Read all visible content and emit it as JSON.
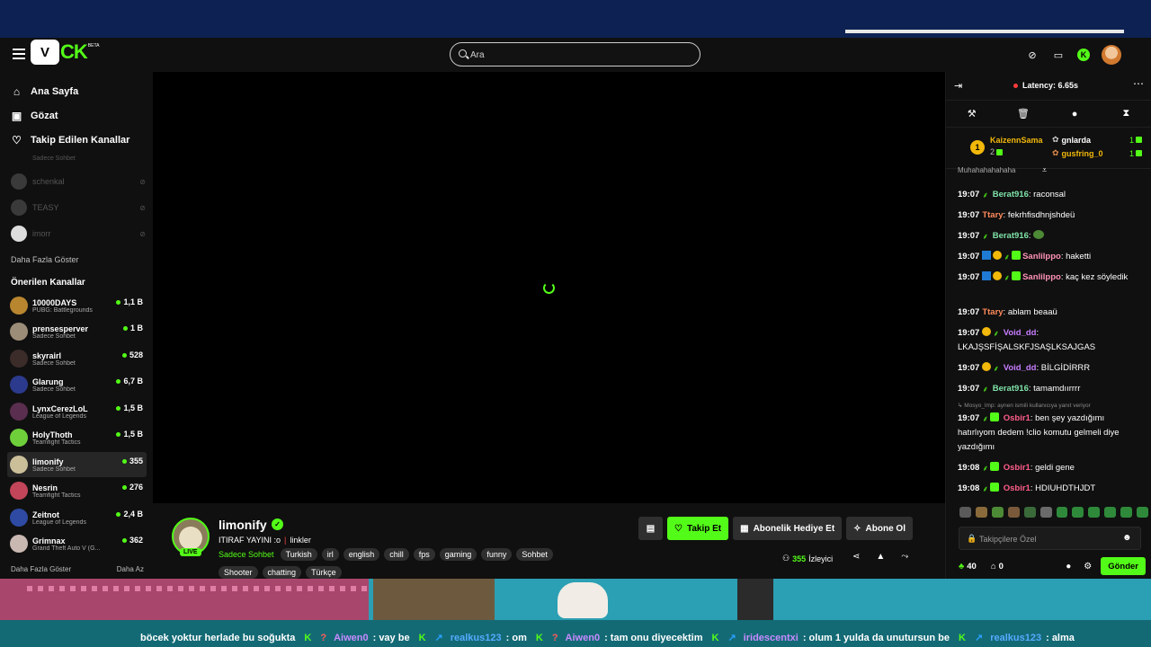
{
  "topbar": {
    "search_placeholder": "Ara",
    "logo_box": "V",
    "logo_k": "CK",
    "logo_beta": "BETA"
  },
  "sidebar": {
    "nav": [
      {
        "label": "Ana Sayfa",
        "icon": "home-icon"
      },
      {
        "label": "Gözat",
        "icon": "browse-icon"
      },
      {
        "label": "Takip Edilen Kanallar",
        "icon": "heart-icon"
      }
    ],
    "follow_partial": "Sadece Sohbet",
    "followed": [
      {
        "name": "schenkal"
      },
      {
        "name": "TEASY"
      },
      {
        "name": "imorr"
      }
    ],
    "show_more": "Daha Fazla Göster",
    "recommended_title": "Önerilen Kanallar",
    "recommended": [
      {
        "name": "10000DAYS",
        "category": "PUBG: Battlegrounds",
        "viewers": "1,1 B",
        "color": "#b8862f"
      },
      {
        "name": "prensesperver",
        "category": "Sadece Sohbet",
        "viewers": "1 B",
        "color": "#9c8d78"
      },
      {
        "name": "skyrairl",
        "category": "Sadece Sohbet",
        "viewers": "528",
        "color": "#3b2c2a"
      },
      {
        "name": "Glarung",
        "category": "Sadece Sohbet",
        "viewers": "6,7 B",
        "color": "#2b3a8c"
      },
      {
        "name": "LynxCerezLoL",
        "category": "League of Legends",
        "viewers": "1,5 B",
        "color": "#5a2e4e"
      },
      {
        "name": "HolyThoth",
        "category": "Teamfight Tactics",
        "viewers": "1,5 B",
        "color": "#6ecf3a"
      },
      {
        "name": "limonify",
        "category": "Sadece Sohbet",
        "viewers": "355",
        "color": "#cbbf9a"
      },
      {
        "name": "Nesrin",
        "category": "Teamfight Tactics",
        "viewers": "276",
        "color": "#c2455a"
      },
      {
        "name": "Zeitnot",
        "category": "League of Legends",
        "viewers": "2,4 B",
        "color": "#2e4aa3"
      },
      {
        "name": "Grimnax",
        "category": "Grand Theft Auto V (G...",
        "viewers": "362",
        "color": "#c9b7b1"
      }
    ],
    "bottom_more": "Daha Fazla Göster",
    "bottom_less": "Daha Az"
  },
  "channel": {
    "name": "limonify",
    "live": "LIVE",
    "title": "ITIRAF YAYINI :o",
    "title_link": "linkler",
    "category": "Sadece Sohbet",
    "tags_row1": [
      "Turkish",
      "irl",
      "english",
      "chill",
      "fps",
      "gaming",
      "funny",
      "Sohbet"
    ],
    "tags_row2": [
      "Shooter",
      "chatting",
      "Türkçe"
    ],
    "follow_label": "Takip Et",
    "gift_label": "Abonelik Hediye Et",
    "subscribe_label": "Abone Ol",
    "viewer_count": "355",
    "viewer_label": "İzleyici"
  },
  "chat": {
    "latency": "Latency: 6.65s",
    "gifters": {
      "top_name": "KaizennSama",
      "top_count": "2",
      "second_name": "gnlarda",
      "second_count": "1",
      "third_name": "gusfring_0",
      "third_count": "1"
    },
    "partial_line": "Muhahahahahaha",
    "messages": [
      {
        "time": "19:07",
        "user": "Berat916",
        "color": "#7fe3a9",
        "text": ": raconsal"
      },
      {
        "time": "19:07",
        "user": "Ttary",
        "color": "#ff8a5b",
        "text": ": fekrhfisdhnjshdeü"
      },
      {
        "time": "19:07",
        "user": "Berat916",
        "color": "#7fe3a9",
        "text": ":"
      },
      {
        "time": "19:07",
        "user": "Sanlilppo",
        "color": "#ff93b5",
        "text": ": haketti"
      },
      {
        "time": "19:07",
        "user": "Sanlilppo",
        "color": "#ff93b5",
        "text": ": kaç kez söyledik"
      },
      {
        "time": "19:07",
        "user": "Ttary",
        "color": "#ff8a5b",
        "text": ": ablam beaaü"
      },
      {
        "time": "19:07",
        "user": "Void_dd",
        "color": "#c77dff",
        "text": ": LKAJŞSFİŞALSKFJSAŞLKSAJGAS"
      },
      {
        "time": "19:07",
        "user": "Void_dd",
        "color": "#c77dff",
        "text": ": BİLGİDİRRR"
      },
      {
        "time": "19:07",
        "user": "Berat916",
        "color": "#7fe3a9",
        "text": ": tamamdıırrrr"
      },
      {
        "time": "19:07",
        "user": "Osbir1",
        "color": "#ff5c8a",
        "text": ": ben şey yazdığımı hatırlıyom dedem !clio komutu gelmeli diye yazdığımı"
      },
      {
        "time": "19:08",
        "user": "Osbir1",
        "color": "#ff5c8a",
        "text": ": geldi gene"
      },
      {
        "time": "19:08",
        "user": "Osbir1",
        "color": "#ff5c8a",
        "text": ": HDIUHDTHJDT"
      }
    ],
    "reply_note": "↳ Mosyo_lmp: aynen ismili kullanıcıya yanıt veriyor",
    "input_placeholder": "Takipçilere Özel",
    "points": "40",
    "items": "0",
    "send_label": "Gönder"
  },
  "ticker": {
    "lead": "böcek yoktur herlade bu soğukta",
    "entries": [
      {
        "user": "Aiwen0",
        "text": "vay be",
        "badge": "q"
      },
      {
        "user": "realkus123",
        "text": "om",
        "badge": "a"
      },
      {
        "user": "Aiwen0",
        "text": "tam onu diyecektim",
        "badge": "q"
      },
      {
        "user": "iridescentxi",
        "text": "olum 1 yulda da unutursun be",
        "badge": "a"
      },
      {
        "user": "realkus123",
        "text": "alma",
        "badge": "a"
      }
    ]
  },
  "colors": {
    "accent": "#53fc18",
    "background": "#101010",
    "player": "#000000",
    "ticker": "#136a75"
  }
}
